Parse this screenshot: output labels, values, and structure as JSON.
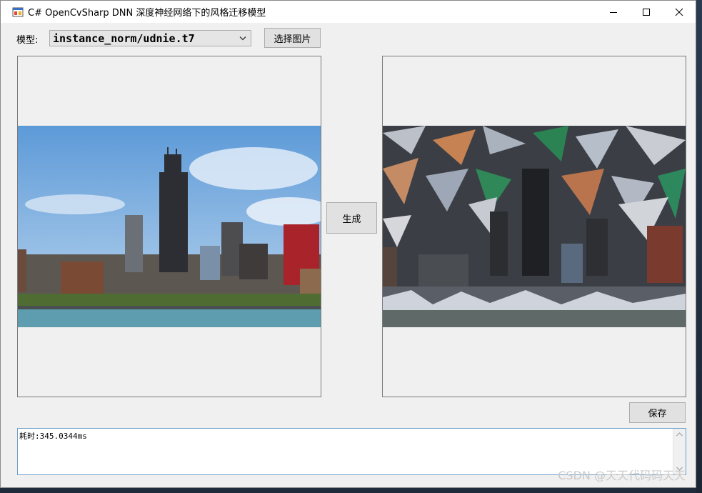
{
  "window": {
    "title": "C# OpenCvSharp DNN 深度神经网络下的风格迁移模型"
  },
  "controls": {
    "model_label": "模型:",
    "model_value": "instance_norm/udnie.t7",
    "select_image_label": "选择图片",
    "generate_label": "生成",
    "save_label": "保存"
  },
  "log": {
    "text": "耗时:345.0344ms"
  },
  "watermark": {
    "text": "CSDN @天天代码码天天"
  },
  "icons": {
    "app": "app-form-icon",
    "minimize": "minimize-icon",
    "maximize": "maximize-icon",
    "close": "close-icon"
  }
}
